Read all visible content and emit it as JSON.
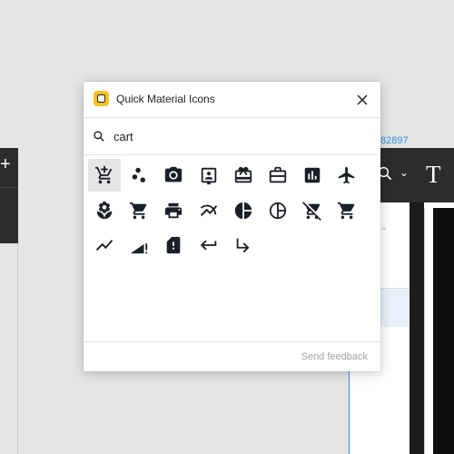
{
  "app": {
    "title": "Quick Material Icons",
    "brand_color": "#f7c325"
  },
  "search": {
    "value": "cart",
    "placeholder": ""
  },
  "background": {
    "id_label": "82897",
    "selection_color": "#2f8fe6"
  },
  "icons": [
    {
      "name": "add-shopping-cart-icon",
      "selected": true
    },
    {
      "name": "scatter-plot-icon"
    },
    {
      "name": "camera-icon"
    },
    {
      "name": "portrait-icon"
    },
    {
      "name": "card-giftcard-icon"
    },
    {
      "name": "work-icon"
    },
    {
      "name": "bar-chart-icon"
    },
    {
      "name": "airplane-icon"
    },
    {
      "name": "local-florist-icon"
    },
    {
      "name": "shopping-cart-icon"
    },
    {
      "name": "print-icon"
    },
    {
      "name": "multiline-chart-icon"
    },
    {
      "name": "pie-chart-icon"
    },
    {
      "name": "pie-chart-outlined-icon"
    },
    {
      "name": "remove-shopping-cart-icon"
    },
    {
      "name": "shopping-cart-alt-icon"
    },
    {
      "name": "show-chart-icon"
    },
    {
      "name": "signal-cellular-alert-icon"
    },
    {
      "name": "sim-card-alert-icon"
    },
    {
      "name": "keyboard-return-icon"
    },
    {
      "name": "subdirectory-arrow-right-icon"
    }
  ],
  "footer": {
    "feedback_label": "Send feedback"
  }
}
